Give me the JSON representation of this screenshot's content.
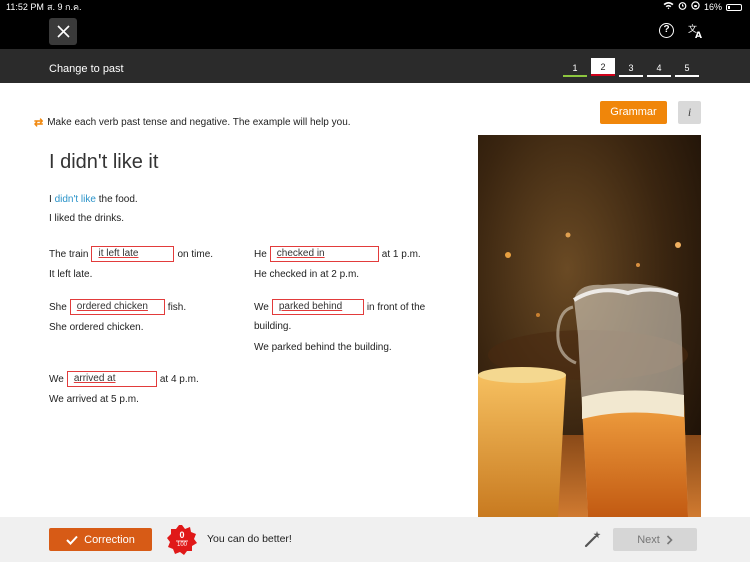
{
  "status": {
    "time": "11:52 PM",
    "date": "ส. 9 ก.ค.",
    "battery": "16%"
  },
  "header": {
    "title": "Change to past",
    "steps": [
      "1",
      "2",
      "3",
      "4",
      "5"
    ],
    "current_step": "2"
  },
  "toolbar": {
    "grammar_label": "Grammar",
    "info_label": "i"
  },
  "instruction": "Make each verb past tense and negative. The example will help you.",
  "lesson": {
    "title": "I didn't like it",
    "example": {
      "pre": "I",
      "highlight": "didn't like",
      "post": "the food.",
      "hint": "I liked the drinks."
    },
    "items": [
      {
        "pre": "The train",
        "answer": "it left late",
        "post": "on time.",
        "hint": "It left late."
      },
      {
        "pre": "He",
        "answer": "checked in",
        "post": "at 1 p.m.",
        "hint": "He checked in at 2 p.m."
      },
      {
        "pre": "She",
        "answer": "ordered chicken",
        "post": "fish.",
        "hint": "She ordered chicken."
      },
      {
        "pre": "We",
        "answer": "parked behind",
        "post": "in front of the",
        "post2": "building.",
        "hint": "We parked behind the building."
      },
      {
        "pre": "We",
        "answer": "arrived at",
        "post": "at 4 p.m.",
        "hint": "We arrived at 5 p.m."
      }
    ]
  },
  "footer": {
    "correction_label": "Correction",
    "score": "0",
    "score_max": "100",
    "feedback": "You can do better!",
    "next_label": "Next"
  },
  "colors": {
    "accent": "#f0860a",
    "correction": "#d75b16",
    "error": "#e23b3b",
    "example": "#2a93c9",
    "done": "#8dc63f"
  }
}
